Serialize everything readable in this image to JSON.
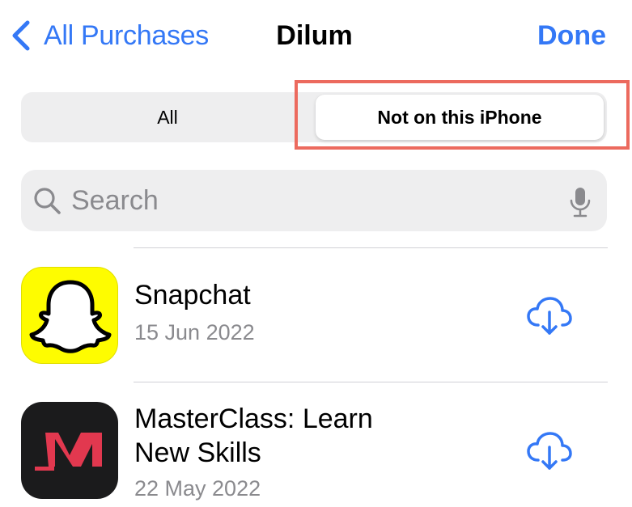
{
  "nav": {
    "back_label": "All Purchases",
    "title": "Dilum",
    "done_label": "Done"
  },
  "segments": {
    "all_label": "All",
    "not_on_label": "Not on this iPhone",
    "selected": "Not on this iPhone"
  },
  "search": {
    "placeholder": "Search",
    "value": ""
  },
  "apps": [
    {
      "name_lines": [
        "Snapchat"
      ],
      "date": "15 Jun 2022",
      "icon": "snapchat-ghost-icon"
    },
    {
      "name_lines": [
        "MasterClass: Learn",
        "New Skills"
      ],
      "date": "22 May 2022",
      "icon": "masterclass-m-icon"
    }
  ],
  "colors": {
    "accent": "#3478f6",
    "highlight": "#ec6a5e",
    "snap_yellow": "#fefc00",
    "masterclass_bg": "#1b1b1c",
    "masterclass_red": "#e2384f"
  }
}
